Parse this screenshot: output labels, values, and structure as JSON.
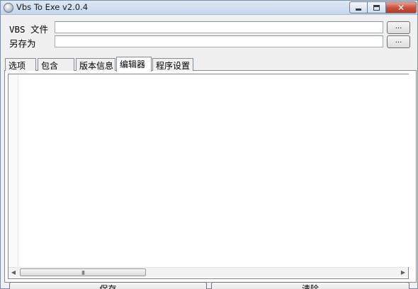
{
  "window": {
    "title": "Vbs To Exe v2.0.4",
    "controls": {
      "minimize": "minimize",
      "maximize": "maximize",
      "close": "✕"
    }
  },
  "form": {
    "vbs_file_label": "VBS 文件",
    "vbs_file_value": "",
    "save_as_label": "另存为",
    "save_as_value": "",
    "browse_label": "..."
  },
  "tabs": [
    {
      "label": "选项",
      "active": false
    },
    {
      "label": "包含",
      "active": false
    },
    {
      "label": "版本信息",
      "active": false
    },
    {
      "label": "编辑器",
      "active": true
    },
    {
      "label": "程序设置",
      "active": false
    }
  ],
  "editor": {
    "content": "",
    "scroll_grip": "III"
  },
  "buttons": {
    "save_label": "保存",
    "clear_label": "清除"
  }
}
